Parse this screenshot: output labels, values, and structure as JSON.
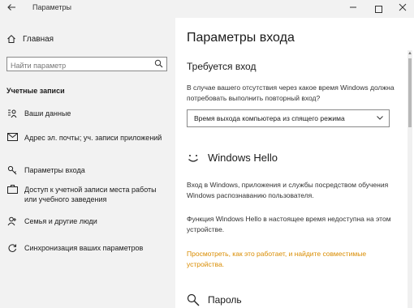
{
  "window": {
    "title": "Параметры",
    "back_icon": "back-arrow-icon",
    "minimize_icon": "minimize-icon",
    "maximize_icon": "maximize-icon",
    "close_icon": "close-icon"
  },
  "sidebar": {
    "home_label": "Главная",
    "home_icon": "home-icon",
    "search": {
      "placeholder": "Найти параметр",
      "icon": "search-icon"
    },
    "section_title": "Учетные записи",
    "items": [
      {
        "label": "Ваши данные",
        "icon": "user-card-icon"
      },
      {
        "label": "Адрес эл. почты; уч. записи приложений",
        "icon": "mail-icon"
      },
      {
        "label": "Параметры входа",
        "icon": "key-icon"
      },
      {
        "label": "Доступ к учетной записи места работы или учебного заведения",
        "icon": "briefcase-icon"
      },
      {
        "label": "Семья и другие люди",
        "icon": "people-icon"
      },
      {
        "label": "Синхронизация ваших параметров",
        "icon": "sync-icon"
      }
    ]
  },
  "main": {
    "title": "Параметры входа",
    "require_signin": {
      "heading": "Требуется вход",
      "description": "В случае вашего отсутствия через какое время Windows должна потребовать выполнить повторный вход?",
      "dropdown_value": "Время выхода компьютера из спящего режима",
      "dropdown_icon": "chevron-down-icon"
    },
    "windows_hello": {
      "icon": "smiley-icon",
      "heading": "Windows Hello",
      "description": "Вход в Windows, приложения и службы посредством обучения Windows распознаванию пользователя.",
      "unavailable_text": "Функция Windows Hello в настоящее время недоступна на этом устройстве.",
      "link_text": "Просмотреть, как это работает, и найдите совместимые устройства."
    },
    "password": {
      "icon": "key-search-icon",
      "heading": "Пароль"
    }
  },
  "colors": {
    "sidebar_bg": "#f2f2f2",
    "accent_link": "#d98c00",
    "text": "#1b1b1b"
  }
}
